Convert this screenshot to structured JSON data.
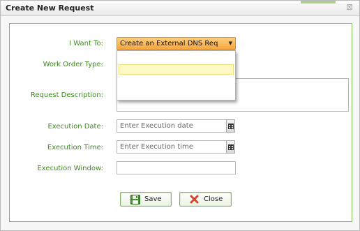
{
  "dialog": {
    "title": "Create New Request"
  },
  "form": {
    "i_want_to_label": "I Want To:",
    "i_want_to_value": "Create an External DNS Req",
    "work_order_type_label": "Work Order Type:",
    "request_description_label": "Request Description:",
    "execution_date_label": "Execution Date:",
    "execution_date_placeholder": "Enter Execution date",
    "execution_time_label": "Execution Time:",
    "execution_time_placeholder": "Enter Execution time",
    "execution_window_label": "Execution Window:"
  },
  "buttons": {
    "save_label": "Save",
    "close_label": "Close"
  },
  "colors": {
    "label_green": "#3c8a1e",
    "panel_border": "#7dbb50",
    "select_orange": "#f6a43c",
    "dropdown_highlight": "#fff9c8"
  },
  "icons": {
    "title_close": "close-x-icon",
    "select_arrow": "triangle-down-icon",
    "calendar": "calendar-icon",
    "save": "floppy-disk-icon",
    "close": "red-x-icon"
  }
}
